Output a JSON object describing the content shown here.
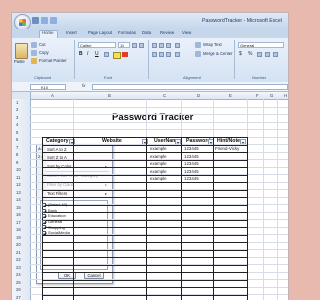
{
  "window": {
    "title": "PasswordTracker - Microsoft Excel"
  },
  "ribbon": {
    "tabs": [
      "Home",
      "Insert",
      "Page Layout",
      "Formulas",
      "Data",
      "Review",
      "View"
    ],
    "clipboard": {
      "paste": "Paste",
      "cut": "Cut",
      "copy": "Copy",
      "format_painter": "Format Painter",
      "group": "Clipboard"
    },
    "font": {
      "name": "Calibri",
      "size": "11",
      "group": "Font",
      "bold": "B",
      "italic": "I",
      "underline": "U"
    },
    "alignment": {
      "wrap": "Wrap Text",
      "merge": "Merge & Center",
      "group": "Alignment"
    },
    "number": {
      "format": "General",
      "group": "Number",
      "currency": "$",
      "percent": "%"
    }
  },
  "formula_bar": {
    "name_box": "K10",
    "fx": "fx",
    "content": ""
  },
  "columns": [
    "A",
    "B",
    "C",
    "D",
    "E",
    "F",
    "G",
    "H"
  ],
  "rows": [
    "1",
    "2",
    "3",
    "4",
    "5",
    "6",
    "7",
    "8",
    "9",
    "10",
    "11",
    "12",
    "13",
    "14",
    "15",
    "16",
    "17",
    "18",
    "19",
    "20",
    "21",
    "22",
    "23",
    "24",
    "25",
    "26",
    "27",
    "28"
  ],
  "sheet": {
    "title": "Password Tracker",
    "headers": [
      "Category",
      "Website",
      "UserName",
      "Password",
      "Hint/Note"
    ],
    "rows": [
      {
        "user": "example",
        "password": "123445",
        "hint": "Friend-Vicky"
      },
      {
        "user": "example",
        "password": "123445",
        "hint": ""
      },
      {
        "user": "example",
        "password": "123445",
        "hint": ""
      },
      {
        "user": "example",
        "password": "123445",
        "hint": ""
      },
      {
        "user": "example",
        "password": "123445",
        "hint": ""
      }
    ]
  },
  "filter_menu": {
    "items": [
      {
        "label": "Sort A to Z",
        "enabled": true
      },
      {
        "label": "Sort Z to A",
        "enabled": true
      },
      {
        "label": "Sort by Color",
        "enabled": true
      },
      {
        "label": "Clear Filter From \"Category\"",
        "enabled": false
      },
      {
        "label": "Filter by Color",
        "enabled": false
      },
      {
        "label": "Text Filters",
        "enabled": true
      }
    ],
    "options": [
      {
        "label": "(Select All)",
        "checked": true
      },
      {
        "label": "Bank",
        "checked": true
      },
      {
        "label": "Education",
        "checked": true
      },
      {
        "label": "General",
        "checked": true
      },
      {
        "label": "Shopping",
        "checked": true
      },
      {
        "label": "SocialMedia",
        "checked": true
      }
    ],
    "ok": "OK",
    "cancel": "Cancel"
  },
  "colors": {
    "accent": "#1f3a66",
    "ribbon": "#d4e2f3",
    "background": "#e8b9ad"
  }
}
